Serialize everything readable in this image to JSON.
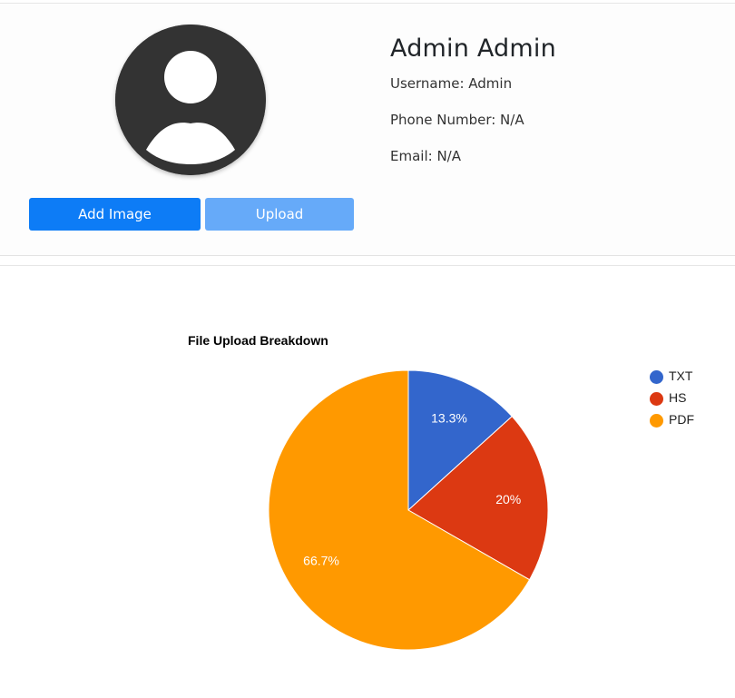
{
  "profile": {
    "full_name": "Admin Admin",
    "username_line": "Username: Admin",
    "phone_line": "Phone Number: N/A",
    "email_line": "Email: N/A",
    "add_image_label": "Add Image",
    "upload_label": "Upload",
    "avatar_icon": "user-avatar-icon"
  },
  "colors": {
    "primary_button": "#0d7cf6",
    "disabled_button": "#66aaf9",
    "avatar_bg": "#333333"
  },
  "chart_data": {
    "type": "pie",
    "title": "File Upload Breakdown",
    "legend_position": "right",
    "slices": [
      {
        "label": "TXT",
        "value": 13.3,
        "display": "13.3%",
        "color": "#3366cc"
      },
      {
        "label": "HS",
        "value": 20.0,
        "display": "20%",
        "color": "#dc3912"
      },
      {
        "label": "PDF",
        "value": 66.7,
        "display": "66.7%",
        "color": "#ff9900"
      }
    ]
  }
}
